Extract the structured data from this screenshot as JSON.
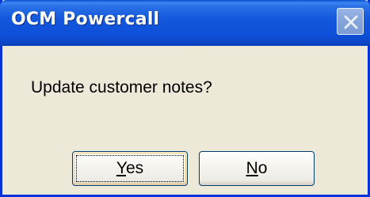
{
  "dialog": {
    "title": "OCM Powercall",
    "message": "Update customer notes?",
    "close_icon": "close-icon",
    "buttons": {
      "yes": {
        "mnemonic": "Y",
        "rest": "es"
      },
      "no": {
        "mnemonic": "N",
        "rest": "o"
      }
    }
  },
  "colors": {
    "titlebar": "#1458dc",
    "frame": "#0831d9",
    "dialog_bg": "#ece9d8",
    "title_text": "#ffffff"
  }
}
